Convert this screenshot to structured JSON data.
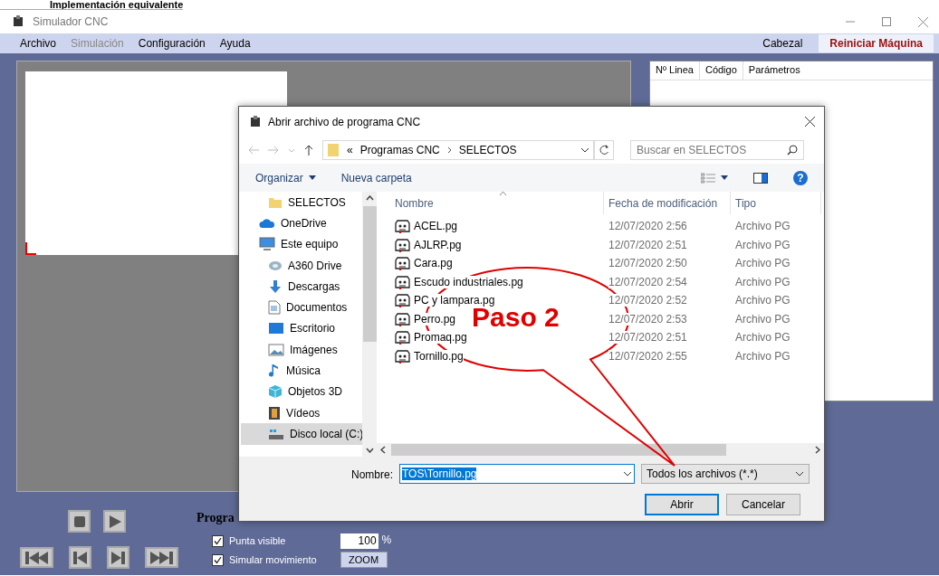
{
  "heading": {
    "text": "Implementación equivalente"
  },
  "window": {
    "title": "Simulador CNC"
  },
  "menu": [
    {
      "label": "Archivo",
      "disabled": false
    },
    {
      "label": "Simulación",
      "disabled": true
    },
    {
      "label": "Configuración",
      "disabled": false
    },
    {
      "label": "Ayuda",
      "disabled": false
    }
  ],
  "menu_right": [
    {
      "label": "Cabezal",
      "highlighted": false
    },
    {
      "label": "Reiniciar Máquina",
      "highlighted": true
    }
  ],
  "program_table": {
    "columns": [
      "Nº Linea",
      "Código",
      "Parámetros"
    ]
  },
  "controls": {
    "label": "Progra",
    "options": [
      {
        "label": "Punta visible",
        "checked": true
      },
      {
        "label": "Simular movimiento",
        "checked": true
      }
    ],
    "zoom_value": "100",
    "zoom_unit": "%",
    "zoom_button": "ZOOM"
  },
  "dialog": {
    "title": "Abrir archivo de programa CNC",
    "breadcrumb_prefix": "«",
    "breadcrumb": [
      "Programas CNC",
      "SELECTOS"
    ],
    "search_placeholder": "Buscar en SELECTOS",
    "toolbar": [
      "Organizar",
      "Nueva carpeta"
    ],
    "help": "?",
    "nav": [
      {
        "label": "SELECTOS",
        "kind": "folder",
        "selected": false
      },
      {
        "label": "OneDrive",
        "kind": "cloud",
        "selected": false
      },
      {
        "label": "Este equipo",
        "kind": "computer",
        "selected": false,
        "children": [
          {
            "label": "A360 Drive",
            "kind": "drive",
            "selected": false
          },
          {
            "label": "Descargas",
            "kind": "download",
            "selected": false
          },
          {
            "label": "Documentos",
            "kind": "document",
            "selected": false
          },
          {
            "label": "Escritorio",
            "kind": "desktop",
            "selected": false
          },
          {
            "label": "Imágenes",
            "kind": "pictures",
            "selected": false
          },
          {
            "label": "Música",
            "kind": "music",
            "selected": false
          },
          {
            "label": "Objetos 3D",
            "kind": "objects",
            "selected": false
          },
          {
            "label": "Vídeos",
            "kind": "videos",
            "selected": false
          },
          {
            "label": "Disco local (C:)",
            "kind": "disk",
            "selected": true
          }
        ]
      }
    ],
    "columns": [
      "Nombre",
      "Fecha de modificación",
      "Tipo"
    ],
    "files": [
      {
        "name": "ACEL.pg",
        "date": "12/07/2020 2:56",
        "type": "Archivo PG"
      },
      {
        "name": "AJLRP.pg",
        "date": "12/07/2020 2:51",
        "type": "Archivo PG"
      },
      {
        "name": "Cara.pg",
        "date": "12/07/2020 2:50",
        "type": "Archivo PG"
      },
      {
        "name": "Escudo industriales.pg",
        "date": "12/07/2020 2:54",
        "type": "Archivo PG"
      },
      {
        "name": "PC y lampara.pg",
        "date": "12/07/2020 2:52",
        "type": "Archivo PG"
      },
      {
        "name": "Perro.pg",
        "date": "12/07/2020 2:53",
        "type": "Archivo PG"
      },
      {
        "name": "Promaq.pg",
        "date": "12/07/2020 2:51",
        "type": "Archivo PG"
      },
      {
        "name": "Tornillo.pg",
        "date": "12/07/2020 2:55",
        "type": "Archivo PG"
      }
    ],
    "filename_label": "Nombre:",
    "filename_value": "TOS\\Tornillo.pg",
    "filetype": "Todos los archivos (*.*)",
    "buttons": [
      "Abrir",
      "Cancelar"
    ]
  },
  "callout": {
    "text": "Paso 2"
  }
}
